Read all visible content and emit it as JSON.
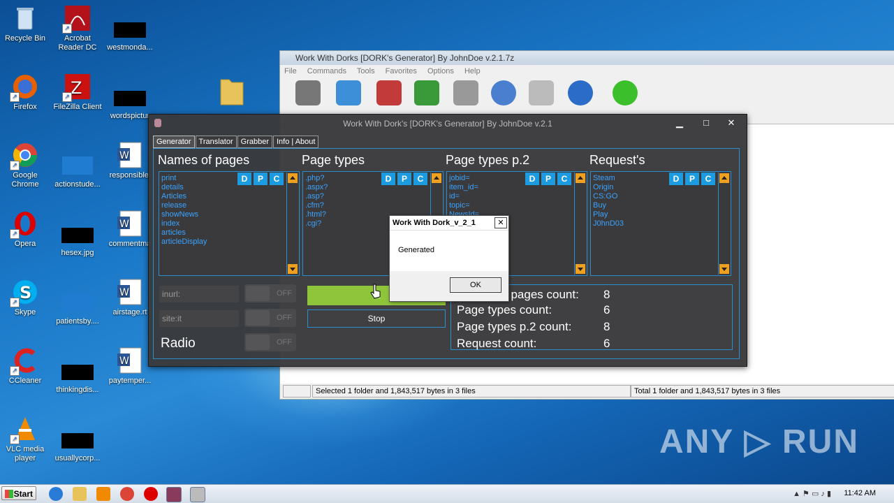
{
  "desktop": {
    "icons": [
      {
        "label": "Recycle Bin"
      },
      {
        "label": "Acrobat\nReader DC"
      },
      {
        "label": "westmonda..."
      },
      {
        "label": "Firefox"
      },
      {
        "label": "FileZilla Client"
      },
      {
        "label": "wordspictur"
      },
      {
        "label": "Google\nChrome"
      },
      {
        "label": "actionstude..."
      },
      {
        "label": "responsiblei"
      },
      {
        "label": "Opera"
      },
      {
        "label": "hesex.jpg"
      },
      {
        "label": "commentma"
      },
      {
        "label": "Skype"
      },
      {
        "label": "patientsby...."
      },
      {
        "label": "airstage.rt"
      },
      {
        "label": "CCleaner"
      },
      {
        "label": "thinkingdis..."
      },
      {
        "label": "paytemper..."
      },
      {
        "label": "VLC media\nplayer"
      },
      {
        "label": "usuallycorp..."
      }
    ]
  },
  "rar_window": {
    "title": "Work With Dorks [DORK's Generator] By JohnDoe v.2.1.7z",
    "menu": [
      "File",
      "Commands",
      "Tools",
      "Favorites",
      "Options",
      "Help"
    ],
    "status_left": "Selected 1 folder and 1,843,517 bytes in 3 files",
    "status_right": "Total 1 folder and 1,843,517 bytes in 3 files"
  },
  "dork_window": {
    "title": "Work With Dork's [DORK's Generator] By JohnDoe v.2.1",
    "tabs": [
      "Generator",
      "Translator",
      "Grabber",
      "Info | About"
    ],
    "sections": {
      "names": {
        "title": "Names of pages",
        "items": [
          "print",
          "details",
          "Articles",
          "release",
          "showNews",
          "index",
          "articles",
          "articleDisplay"
        ]
      },
      "types": {
        "title": "Page types",
        "items": [
          ".php?",
          ".aspx?",
          ".asp?",
          ".cfm?",
          ".html?",
          ".cgi?"
        ]
      },
      "types2": {
        "title": "Page types p.2",
        "items": [
          "jobid=",
          "item_id=",
          "id=",
          "topic=",
          "NewsId="
        ]
      },
      "requests": {
        "title": "Request's",
        "items": [
          "Steam",
          "Origin",
          "CS:GO",
          "Buy",
          "Play",
          "J0hnD03"
        ]
      }
    },
    "dpc": [
      "D",
      "P",
      "C"
    ],
    "options": {
      "inurl": "inurl:",
      "site": "site:it",
      "radio": "Radio",
      "off": "OFF"
    },
    "buttons": {
      "start": "St",
      "stop": "Stop"
    },
    "counts": [
      {
        "label": "Names of pages count:",
        "value": "8"
      },
      {
        "label": "Page types count:",
        "value": "6"
      },
      {
        "label": "Page types p.2 count:",
        "value": "8"
      },
      {
        "label": "Request count:",
        "value": "6"
      }
    ]
  },
  "message_box": {
    "title": "Work With Dork_v_2_1",
    "text": "Generated",
    "ok": "OK",
    "close": "✕"
  },
  "taskbar": {
    "start": "Start",
    "clock": "11:42 AM"
  },
  "watermark": "ANY ▷ RUN"
}
